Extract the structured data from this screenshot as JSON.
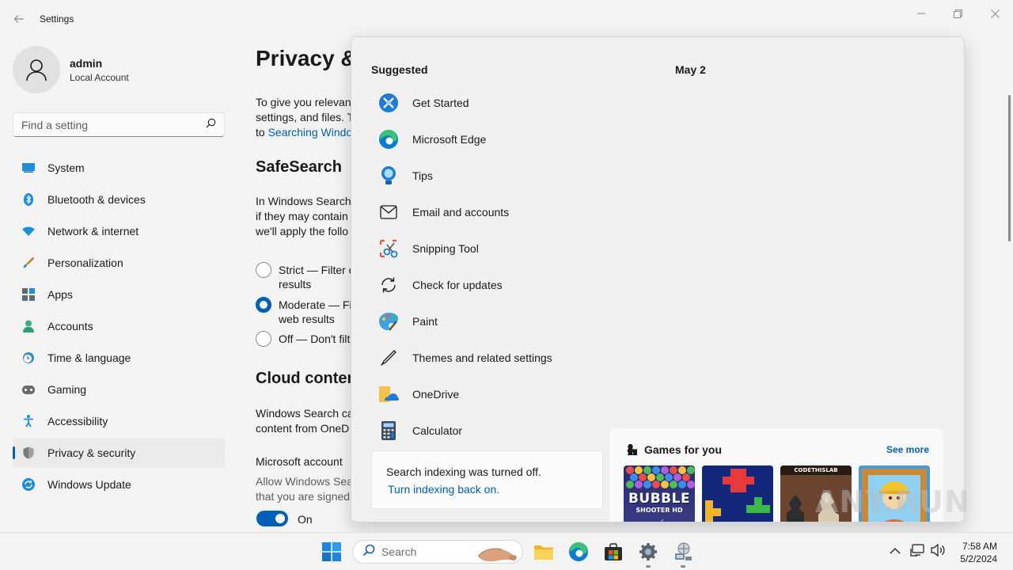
{
  "window": {
    "title": "Settings"
  },
  "profile": {
    "name": "admin",
    "account_type": "Local Account"
  },
  "search": {
    "placeholder": "Find a setting"
  },
  "sidebar": {
    "items": [
      {
        "label": "System",
        "icon": "system-icon"
      },
      {
        "label": "Bluetooth & devices",
        "icon": "bluetooth-icon"
      },
      {
        "label": "Network & internet",
        "icon": "wifi-icon"
      },
      {
        "label": "Personalization",
        "icon": "brush-icon"
      },
      {
        "label": "Apps",
        "icon": "apps-icon"
      },
      {
        "label": "Accounts",
        "icon": "accounts-icon"
      },
      {
        "label": "Time & language",
        "icon": "clock-globe-icon"
      },
      {
        "label": "Gaming",
        "icon": "controller-icon"
      },
      {
        "label": "Accessibility",
        "icon": "accessibility-icon"
      },
      {
        "label": "Privacy & security",
        "icon": "shield-icon",
        "active": true
      },
      {
        "label": "Windows Update",
        "icon": "update-icon"
      }
    ]
  },
  "main": {
    "title": "Privacy &",
    "intro": [
      "To give you relevant",
      "settings, and files. T",
      "to "
    ],
    "intro_link": "Searching Windo",
    "safesearch": {
      "title": "SafeSearch",
      "desc": [
        "In Windows Search,",
        "if they may contain",
        "we'll apply the follo"
      ],
      "options": [
        {
          "label": "Strict — Filter c",
          "sub": "results",
          "selected": false
        },
        {
          "label": "Moderate — Fi",
          "sub": "web results",
          "selected": true
        },
        {
          "label": "Off — Don't filt",
          "sub": "",
          "selected": false
        }
      ]
    },
    "cloud": {
      "title": "Cloud conten",
      "desc": [
        "Windows Search ca",
        "content from OneD"
      ],
      "ms_account_label": "Microsoft account",
      "ms_account_desc": [
        "Allow Windows Sea",
        "that you are signed"
      ],
      "toggle_label": "On"
    }
  },
  "start_menu": {
    "suggested_title": "Suggested",
    "date": "May 2",
    "suggested": [
      {
        "label": "Get Started",
        "icon": "get-started-icon"
      },
      {
        "label": "Microsoft Edge",
        "icon": "edge-icon"
      },
      {
        "label": "Tips",
        "icon": "tips-icon"
      },
      {
        "label": "Email and accounts",
        "icon": "email-icon"
      },
      {
        "label": "Snipping Tool",
        "icon": "snipping-tool-icon"
      },
      {
        "label": "Check for updates",
        "icon": "refresh-icon"
      },
      {
        "label": "Paint",
        "icon": "paint-icon"
      },
      {
        "label": "Themes and related settings",
        "icon": "pen-icon"
      },
      {
        "label": "OneDrive",
        "icon": "onedrive-icon"
      },
      {
        "label": "Calculator",
        "icon": "calculator-icon"
      }
    ],
    "indexing": {
      "message": "Search indexing was turned off.",
      "link": "Turn indexing back on."
    },
    "games": {
      "title": "Games for you",
      "see_more": "See more",
      "tiles": [
        {
          "label_line1": "BUBBLE",
          "label_line2": "SHOOTER",
          "badge": "HD"
        },
        {
          "label_line1": "",
          "label_line2": "",
          "badge": ""
        },
        {
          "label_line1": "CODETHISLAB",
          "label_line2": "",
          "badge": ""
        },
        {
          "label_line1": "",
          "label_line2": "",
          "badge": ""
        }
      ]
    }
  },
  "taskbar": {
    "search_placeholder": "Search",
    "time": "7:58 AM",
    "date": "5/2/2024"
  },
  "watermark": "ANY.RUN"
}
